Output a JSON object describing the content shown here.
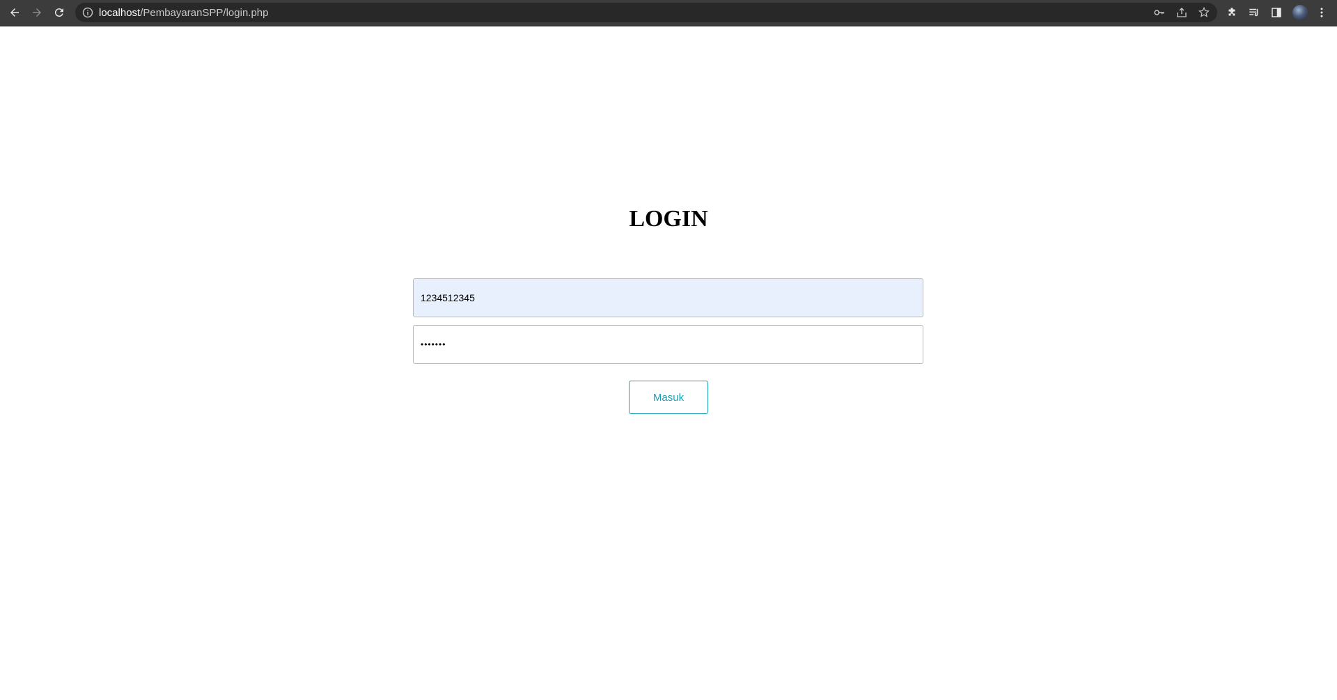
{
  "browser": {
    "url_host": "localhost",
    "url_path": "/PembayaranSPP/login.php",
    "icons": [
      "back-icon",
      "forward-icon",
      "reload-icon",
      "site-info-icon",
      "key-icon",
      "share-icon",
      "star-icon",
      "extensions-icon",
      "reading-list-icon",
      "side-panel-icon",
      "profile-avatar",
      "menu-icon"
    ]
  },
  "page": {
    "title": "LOGIN",
    "username_value": "1234512345",
    "password_masked": "•••••••",
    "submit_label": "Masuk"
  },
  "colors": {
    "accent": "#17a2b8",
    "autofill_bg": "#e8f0fe",
    "chrome_bg": "#3c3c3c"
  }
}
